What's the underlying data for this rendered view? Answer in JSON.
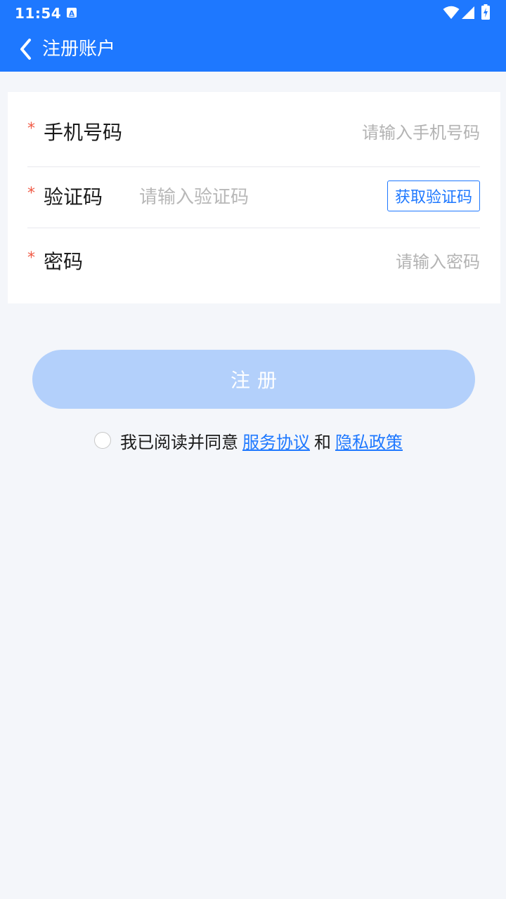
{
  "status_bar": {
    "time": "11:54",
    "notification_icon": "a-box-icon",
    "wifi_icon": "wifi-icon",
    "signal_icon": "signal-icon",
    "battery_icon": "battery-charging-icon"
  },
  "nav": {
    "back_icon": "chevron-left-icon",
    "title": "注册账户"
  },
  "form": {
    "required_mark": "*",
    "phone": {
      "label": "手机号码",
      "placeholder": "请输入手机号码",
      "value": ""
    },
    "code": {
      "label": "验证码",
      "placeholder": "请输入验证码",
      "value": "",
      "get_code_label": "获取验证码"
    },
    "password": {
      "label": "密码",
      "placeholder": "请输入密码",
      "value": ""
    }
  },
  "register_button": {
    "label": "注册"
  },
  "agreement": {
    "checked": false,
    "prefix": "我已阅读并同意",
    "service_link": "服务协议",
    "conjunction": "和",
    "privacy_link": "隐私政策"
  },
  "colors": {
    "header": "#1e78ff",
    "background": "#f4f6fa",
    "required": "#f05a45",
    "link": "#1e78ff",
    "button_disabled": "#b3d0fb"
  }
}
